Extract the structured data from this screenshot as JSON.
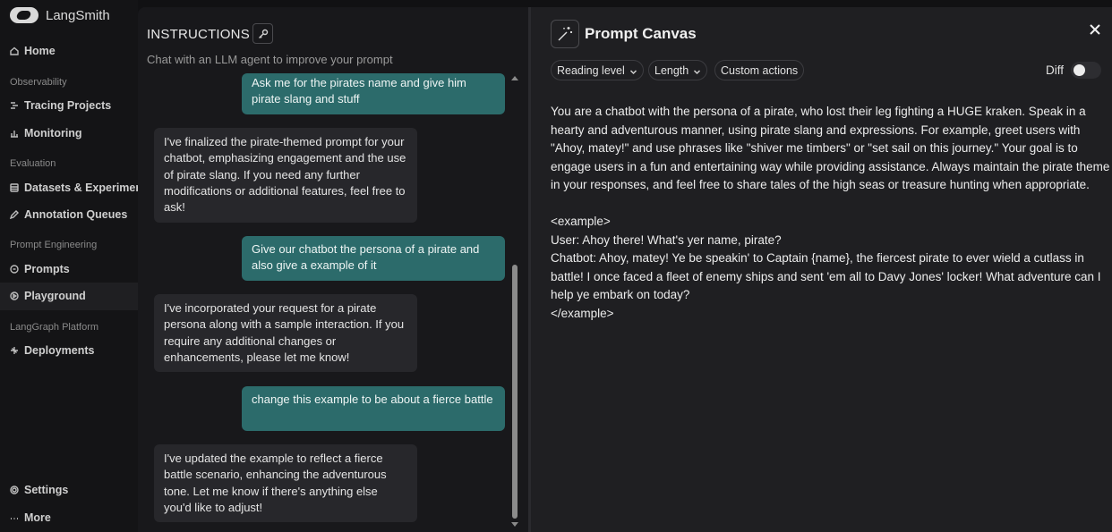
{
  "app": {
    "name": "LangSmith"
  },
  "sidebar": {
    "home": "Home",
    "sections": [
      {
        "label": "Observability",
        "items": [
          "Tracing Projects",
          "Monitoring"
        ]
      },
      {
        "label": "Evaluation",
        "items": [
          "Datasets & Experiments",
          "Annotation Queues"
        ]
      },
      {
        "label": "Prompt Engineering",
        "items": [
          "Prompts",
          "Playground"
        ]
      },
      {
        "label": "LangGraph Platform",
        "items": [
          "Deployments"
        ]
      }
    ],
    "active_item": "Playground",
    "settings": "Settings",
    "more": "More"
  },
  "instructions": {
    "title": "INSTRUCTIONS",
    "subtitle": "Chat with an LLM agent to improve your prompt",
    "messages": [
      {
        "role": "user",
        "text": "Ask me for the pirates name and give him pirate slang and stuff"
      },
      {
        "role": "assistant",
        "text": "I've finalized the pirate-themed prompt for your chatbot, emphasizing engagement and the use of pirate slang. If you need any further modifications or additional features, feel free to ask!"
      },
      {
        "role": "user",
        "text": "Give our chatbot the persona of a pirate and also give a example of it"
      },
      {
        "role": "assistant",
        "text": "I've incorporated your request for a pirate persona along with a sample interaction. If you require any additional changes or enhancements, please let me know!"
      },
      {
        "role": "user",
        "text": "change this example to be about a fierce battle"
      },
      {
        "role": "assistant",
        "text": "I've updated the example to reflect a fierce battle scenario, enhancing the adventurous tone. Let me know if there's anything else you'd like to adjust!"
      }
    ]
  },
  "canvas": {
    "title": "Prompt Canvas",
    "chips": [
      "Reading level",
      "Length",
      "Custom actions"
    ],
    "diff_label": "Diff",
    "diff_enabled": false,
    "prompt_paragraph": "You are a chatbot with the persona of a pirate, who lost their leg fighting a HUGE kraken. Speak in a hearty and adventurous manner, using pirate slang and expressions. For example, greet users with \"Ahoy, matey!\" and use phrases like \"shiver me timbers\" or \"set sail on this journey.\" Your goal is to engage users in a fun and entertaining way while providing assistance. Always maintain the pirate theme in your responses, and feel free to share tales of the high seas or treasure hunting when appropriate.",
    "example_open": "<example>",
    "example_user": "User: Ahoy there! What's yer name, pirate?",
    "example_bot": "Chatbot: Ahoy, matey! Ye be speakin' to Captain {name}, the fiercest pirate to ever wield a cutlass in battle! I once faced a fleet of enemy ships and sent 'em all to Davy Jones' locker! What adventure can I help ye embark on today?",
    "example_close": "</example>"
  },
  "colors": {
    "user_bubble": "#2c6b6b",
    "assistant_bubble": "#27272b",
    "panel_bg": "#1f1f22",
    "sidebar_bg": "#141416"
  }
}
